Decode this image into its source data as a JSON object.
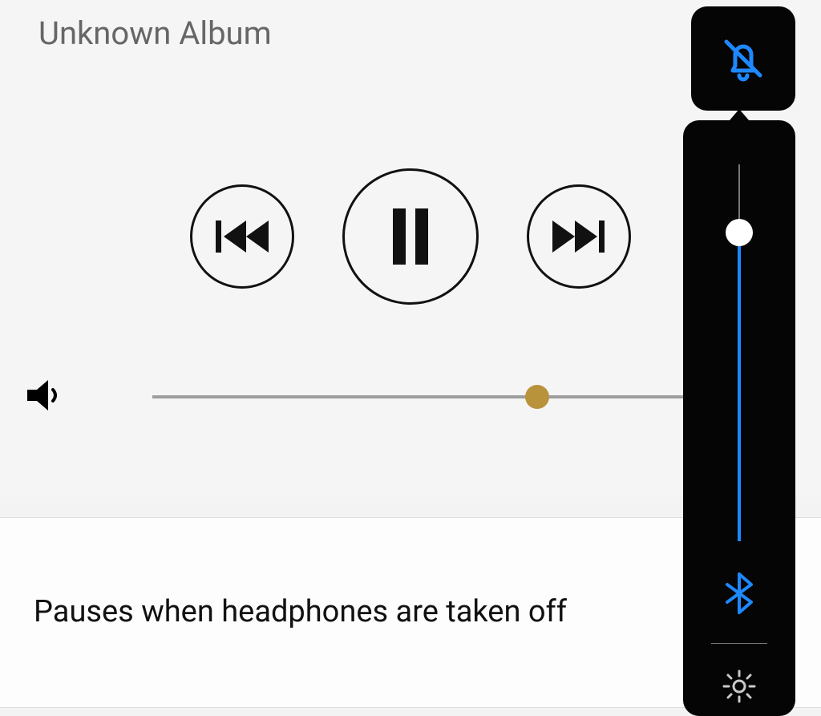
{
  "player": {
    "album_title": "Unknown Album",
    "volume_percent": 62
  },
  "settings": {
    "headphone_pause_label": "Pauses when headphones are taken off"
  },
  "volume_panel": {
    "level_percent": 82
  },
  "icons": {
    "prev": "skip-previous-icon",
    "pause": "pause-icon",
    "next": "skip-next-icon",
    "speaker": "speaker-icon",
    "dnd": "bell-off-icon",
    "bluetooth": "bluetooth-icon",
    "gear": "gear-icon"
  },
  "colors": {
    "accent_blue": "#1e88ff",
    "slider_gold": "#b9933b",
    "panel_black": "#050505"
  }
}
